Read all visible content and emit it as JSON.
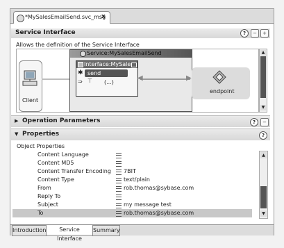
{
  "editor_tab": {
    "title": "*MySalesEmailSend.svc_msg",
    "close": "x"
  },
  "service_interface": {
    "title": "Service Interface",
    "description": "Allows the definition of the Service Interface",
    "service_label": "Service:MySalesEmailSend",
    "interface_label": "Interface:MySale",
    "operation": "send",
    "params": "(...)",
    "client_label": "Client",
    "endpoint_label": "endpoint"
  },
  "operation_parameters": {
    "title": "Operation Parameters"
  },
  "properties": {
    "title": "Properties",
    "subtitle": "Object Properties",
    "rows": [
      {
        "name": "Content Language",
        "value": ""
      },
      {
        "name": "Content MD5",
        "value": ""
      },
      {
        "name": "Content Transfer Encoding",
        "value": "7BIT"
      },
      {
        "name": "Content Type",
        "value": "text/plain"
      },
      {
        "name": "From",
        "value": "rob.thomas@sybase.com"
      },
      {
        "name": "Reply To",
        "value": ""
      },
      {
        "name": "Subject",
        "value": "my message test"
      },
      {
        "name": "To",
        "value": "rob.thomas@sybase.com"
      }
    ]
  },
  "bottom_tabs": [
    "Introduction",
    "Service Interface",
    "Summary"
  ],
  "colors": {
    "selected_row": "#c8c8c8",
    "header_bg": "#dddddd"
  }
}
